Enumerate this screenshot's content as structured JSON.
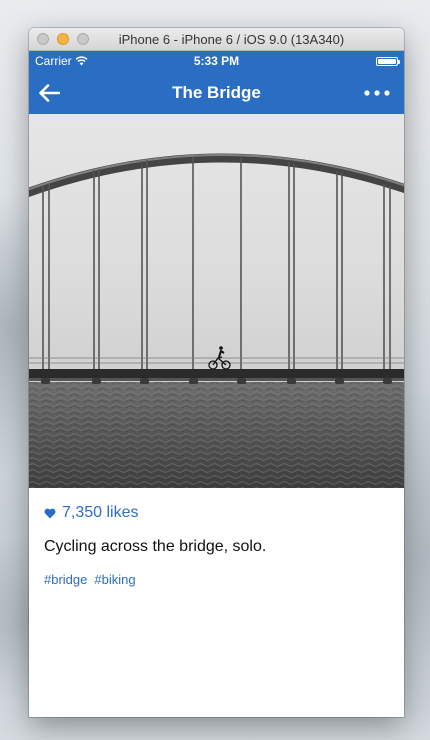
{
  "window": {
    "title": "iPhone 6 - iPhone 6 / iOS 9.0 (13A340)"
  },
  "status_bar": {
    "carrier": "Carrier",
    "time": "5:33 PM",
    "battery_level": 1.0
  },
  "nav": {
    "title": "The Bridge",
    "back_icon": "arrow-left-icon",
    "more_icon": "ellipsis-icon"
  },
  "post": {
    "likes_icon": "heart-icon",
    "likes_text": "7,350 likes",
    "caption": "Cycling across the bridge, solo.",
    "tags": [
      "#bridge",
      "#biking"
    ]
  },
  "colors": {
    "accent": "#2a6ec4",
    "header_background": "#2a6ec4",
    "body_text": "#111111",
    "window_background": "#ffffff"
  }
}
